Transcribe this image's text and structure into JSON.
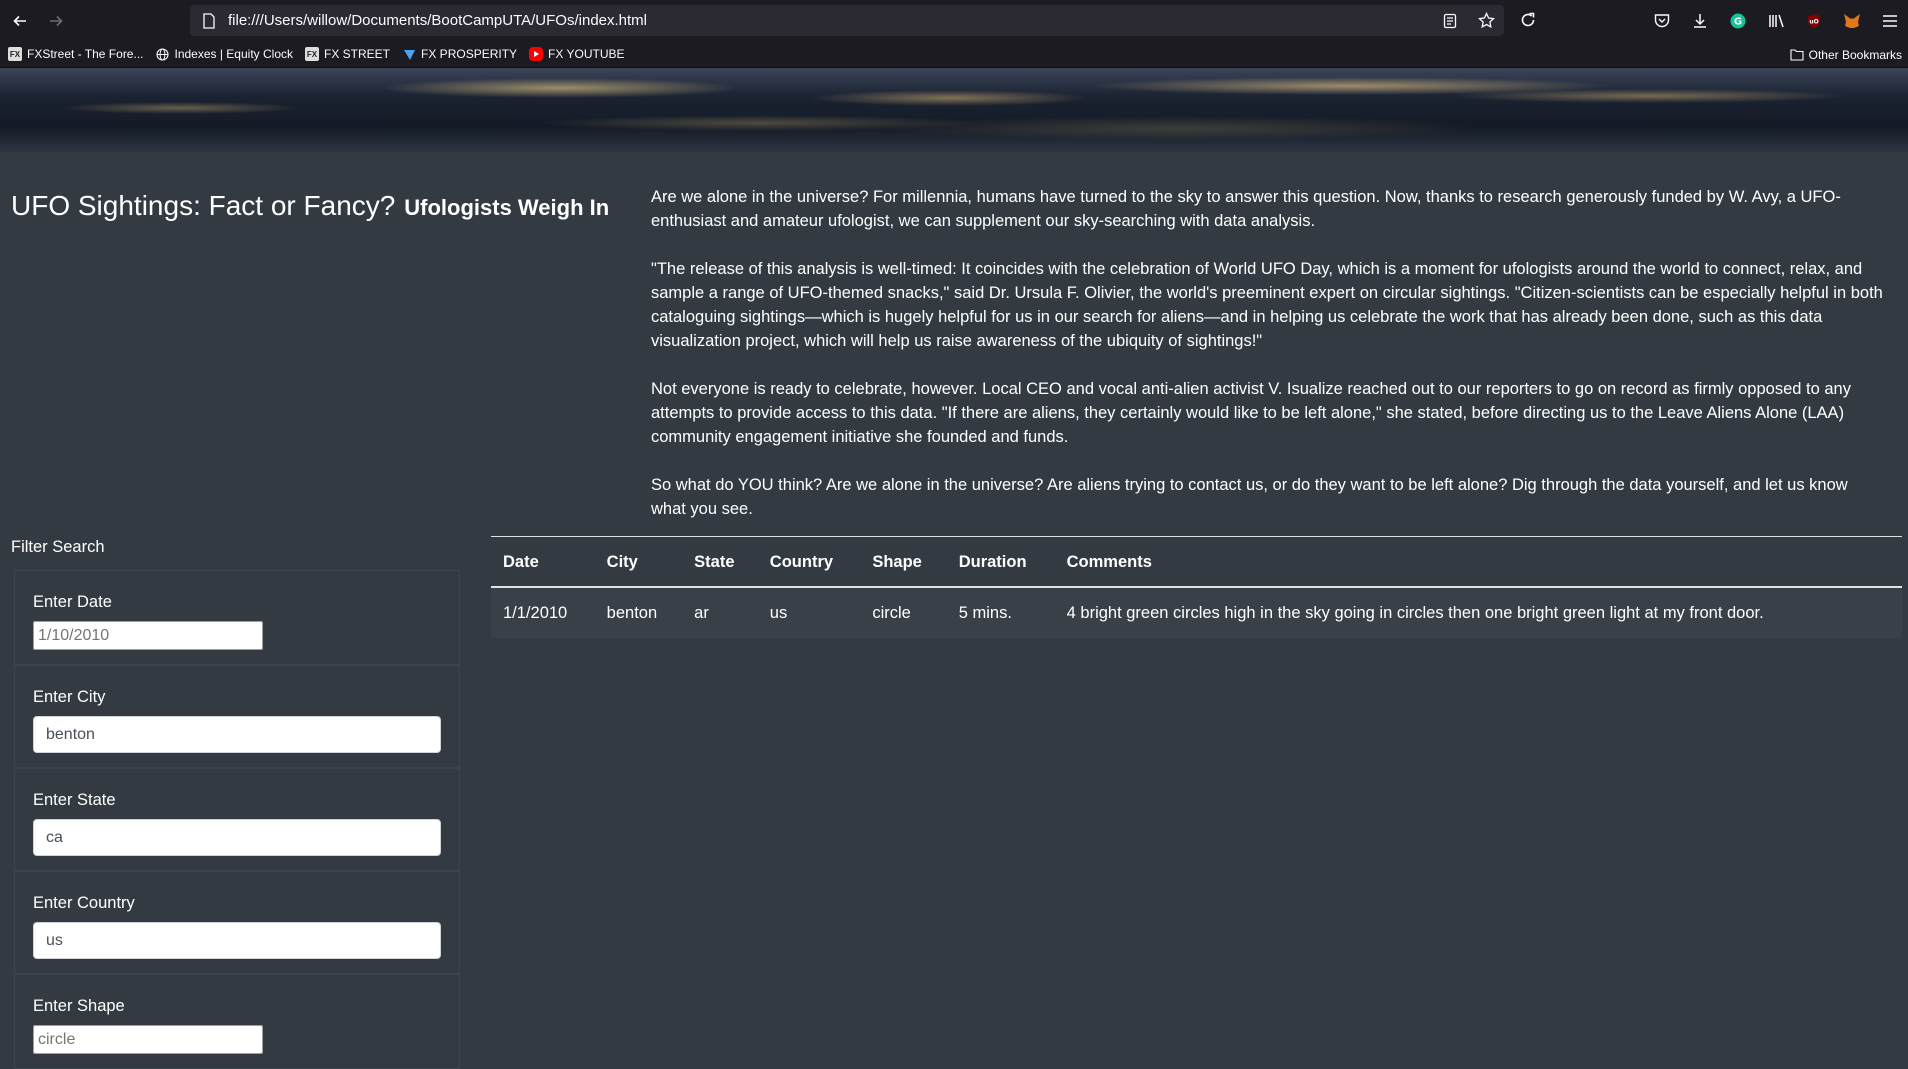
{
  "browser": {
    "url": "file:///Users/willow/Documents/BootCampUTA/UFOs/index.html",
    "bookmarks": [
      {
        "label": "FXStreet - The Fore...",
        "icon": "fxstreet-icon"
      },
      {
        "label": "Indexes | Equity Clock",
        "icon": "globe-icon"
      },
      {
        "label": "FX STREET",
        "icon": "fxstreet-icon"
      },
      {
        "label": "FX PROSPERITY",
        "icon": "prosperity-icon"
      },
      {
        "label": "FX YOUTUBE",
        "icon": "youtube-icon"
      }
    ],
    "other_bookmarks": "Other Bookmarks"
  },
  "page": {
    "title": "UFO Sightings: Fact or Fancy?",
    "subtitle": "Ufologists Weigh In",
    "paragraphs": [
      "Are we alone in the universe? For millennia, humans have turned to the sky to answer this question. Now, thanks to research generously funded by W. Avy, a UFO-enthusiast and amateur ufologist, we can supplement our sky-searching with data analysis.",
      "\"The release of this analysis is well-timed: It coincides with the celebration of World UFO Day, which is a moment for ufologists around the world to connect, relax, and sample a range of UFO-themed snacks,\" said Dr. Ursula F. Olivier, the world's preeminent expert on circular sightings. \"Citizen-scientists can be especially helpful in both cataloguing sightings—which is hugely helpful for us in our search for aliens—and in helping us celebrate the work that has already been done, such as this data visualization project, which will help us raise awareness of the ubiquity of sightings!\"",
      "Not everyone is ready to celebrate, however. Local CEO and vocal anti-alien activist V. Isualize reached out to our reporters to go on record as firmly opposed to any attempts to provide access to this data. \"If there are aliens, they certainly would like to be left alone,\" she stated, before directing us to the Leave Aliens Alone (LAA) community engagement initiative she founded and funds.",
      "So what do YOU think? Are we alone in the universe? Are aliens trying to contact us, or do they want to be left alone? Dig through the data yourself, and let us know what you see."
    ]
  },
  "filters": {
    "heading": "Filter Search",
    "date": {
      "label": "Enter Date",
      "placeholder": "1/10/2010",
      "value": ""
    },
    "city": {
      "label": "Enter City",
      "value": "benton"
    },
    "state": {
      "label": "Enter State",
      "value": "ca"
    },
    "country": {
      "label": "Enter Country",
      "value": "us"
    },
    "shape": {
      "label": "Enter Shape",
      "placeholder": "circle",
      "value": ""
    }
  },
  "table": {
    "headers": [
      "Date",
      "City",
      "State",
      "Country",
      "Shape",
      "Duration",
      "Comments"
    ],
    "rows": [
      [
        "1/1/2010",
        "benton",
        "ar",
        "us",
        "circle",
        "5 mins.",
        "4 bright green circles high in the sky going in circles then one bright green light at my front door."
      ]
    ]
  }
}
